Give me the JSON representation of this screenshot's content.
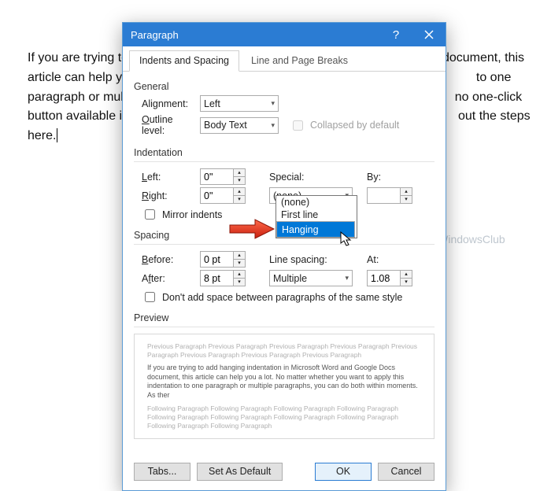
{
  "background_text_lines": [
    "If you are trying to",
    "document, this",
    "article can help yo",
    "to one",
    "paragraph or mul",
    "no one-click",
    "button available i",
    "out the steps",
    "here."
  ],
  "watermark": "TheWindowsClub",
  "titlebar": {
    "title": "Paragraph"
  },
  "tabs": {
    "indents": "Indents and Spacing",
    "breaks": "Line and Page Breaks"
  },
  "general": {
    "group": "General",
    "alignment_label": "Alignment:",
    "alignment_value": "Left",
    "outline_label": "Outline level:",
    "outline_value": "Body Text",
    "collapsed": "Collapsed by default"
  },
  "indent": {
    "group": "Indentation",
    "left_label": "Left:",
    "left_value": "0\"",
    "right_label": "Right:",
    "right_value": "0\"",
    "special_label": "Special:",
    "special_value": "(none)",
    "by_label": "By:",
    "by_value": "",
    "mirror": "Mirror indents",
    "options": {
      "none": "(none)",
      "first": "First line",
      "hanging": "Hanging"
    }
  },
  "spacing": {
    "group": "Spacing",
    "before_label": "Before:",
    "before_value": "0 pt",
    "after_label": "After:",
    "after_value": "8 pt",
    "line_label": "Line spacing:",
    "line_value": "Multiple",
    "at_label": "At:",
    "at_value": "1.08",
    "nospace": "Don't add space between paragraphs of the same style"
  },
  "preview": {
    "group": "Preview",
    "prev_text": "Previous Paragraph Previous Paragraph Previous Paragraph Previous Paragraph Previous Paragraph Previous Paragraph Previous Paragraph Previous Paragraph",
    "live_text": "If you are trying to add hanging indentation in Microsoft Word and Google Docs document, this article can help you a lot. No matter whether you want to apply this indentation to one paragraph or multiple paragraphs, you can do both within moments. As ther",
    "next_text": "Following Paragraph Following Paragraph Following Paragraph Following Paragraph Following Paragraph Following Paragraph Following Paragraph Following Paragraph Following Paragraph Following Paragraph"
  },
  "footer": {
    "tabs": "Tabs...",
    "default": "Set As Default",
    "ok": "OK",
    "cancel": "Cancel"
  }
}
